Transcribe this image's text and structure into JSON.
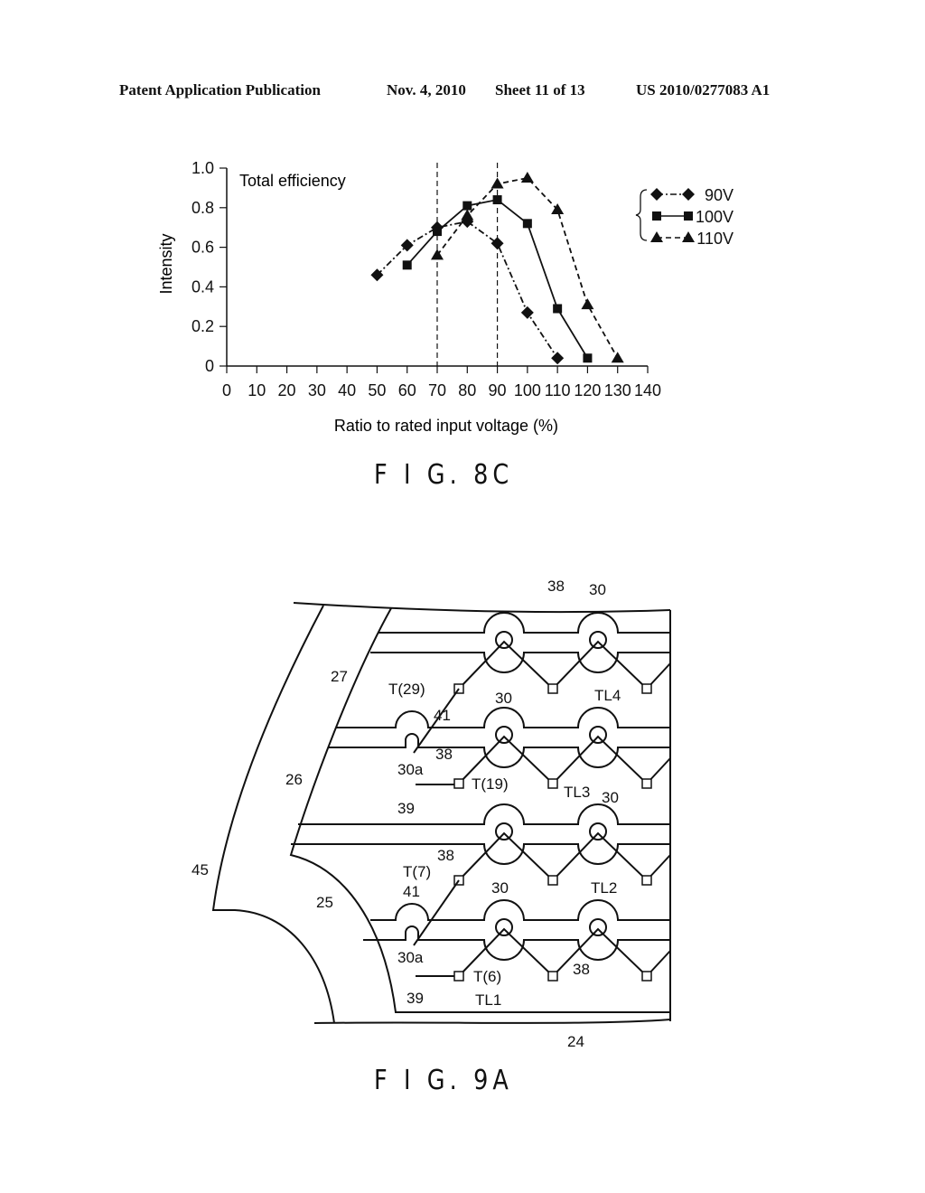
{
  "header": {
    "publication": "Patent Application Publication",
    "date": "Nov. 4, 2010",
    "sheet": "Sheet 11 of 13",
    "number": "US 2010/0277083 A1"
  },
  "figures": {
    "fig8c_label": "F I G. 8C",
    "fig9a_label": "F I G. 9A"
  },
  "chart_data": {
    "type": "line",
    "title": "Total efficiency",
    "xlabel": "Ratio to rated input voltage (%)",
    "ylabel": "Intensity",
    "xlim": [
      0,
      140
    ],
    "ylim": [
      0,
      1.0
    ],
    "xticks": [
      "0",
      "10",
      "20",
      "30",
      "40",
      "50",
      "60",
      "70",
      "80",
      "90",
      "100",
      "110",
      "120",
      "130",
      "140"
    ],
    "yticks": [
      "0",
      "0.2",
      "0.4",
      "0.6",
      "0.8",
      "1.0"
    ],
    "reference_lines_x": [
      70,
      90
    ],
    "legend_position": "right",
    "series": [
      {
        "name": "90V",
        "marker": "diamond",
        "style": "dash-dot",
        "x": [
          50,
          60,
          70,
          80,
          90,
          100,
          110
        ],
        "values": [
          0.46,
          0.61,
          0.7,
          0.73,
          0.62,
          0.27,
          0.04
        ]
      },
      {
        "name": "100V",
        "marker": "square",
        "style": "solid",
        "x": [
          60,
          70,
          80,
          90,
          100,
          110,
          120
        ],
        "values": [
          0.51,
          0.68,
          0.81,
          0.84,
          0.72,
          0.29,
          0.04
        ]
      },
      {
        "name": "110V",
        "marker": "triangle",
        "style": "dashed",
        "x": [
          70,
          80,
          90,
          100,
          110,
          120,
          130
        ],
        "values": [
          0.56,
          0.76,
          0.92,
          0.95,
          0.79,
          0.31,
          0.04
        ]
      }
    ]
  },
  "diagram": {
    "labels": {
      "l38_top": "38",
      "l30_top": "30",
      "l27": "27",
      "lT29": "T(29)",
      "lTL4": "TL4",
      "l41_top": "41",
      "l30_mid": "30",
      "l30a_top": "30a",
      "l38_mid": "38",
      "l26": "26",
      "lT19": "T(19)",
      "l39_top": "39",
      "lTL3": "TL3",
      "l30_r": "30",
      "l45": "45",
      "l38_low": "38",
      "lT7": "T(7)",
      "l41_low": "41",
      "l25": "25",
      "lTL2": "TL2",
      "l30_low": "30",
      "l30a_low": "30a",
      "lT6": "T(6)",
      "l38_bot": "38",
      "l39_bot": "39",
      "lTL1": "TL1",
      "l24": "24"
    }
  }
}
